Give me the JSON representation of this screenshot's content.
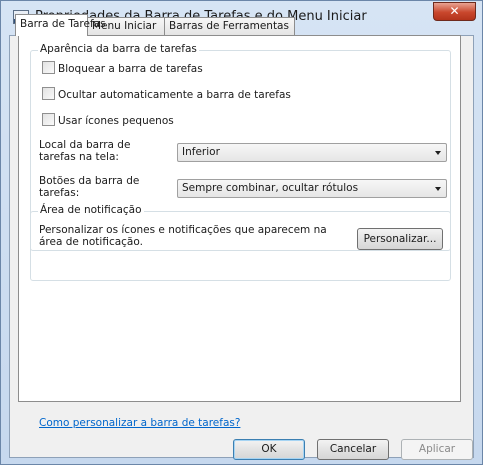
{
  "window": {
    "title": "Propriedades da Barra de Tarefas e do Menu Iniciar",
    "close_symbol": "✕"
  },
  "tabs": [
    {
      "label": "Barra de Tarefas",
      "active": true
    },
    {
      "label": "Menu Iniciar",
      "active": false
    },
    {
      "label": "Barras de Ferramentas",
      "active": false
    }
  ],
  "appearance": {
    "legend": "Aparência da barra de tarefas",
    "checkboxes": [
      {
        "label": "Bloquear a barra de tarefas",
        "checked": false
      },
      {
        "label": "Ocultar automaticamente a barra de tarefas",
        "checked": false
      },
      {
        "label": "Usar ícones pequenos",
        "checked": false
      }
    ],
    "location_label": "Local da barra de tarefas na tela:",
    "location_value": "Inferior",
    "buttons_label": "Botões da barra de tarefas:",
    "buttons_value": "Sempre combinar, ocultar rótulos"
  },
  "notification": {
    "legend": "Área de notificação",
    "description": "Personalizar os ícones e notificações que aparecem na área de notificação.",
    "customize_button": "Personalizar..."
  },
  "help_link": "Como personalizar a barra de tarefas?",
  "footer": {
    "ok": "OK",
    "cancel": "Cancelar",
    "apply": "Aplicar"
  },
  "colors": {
    "link": "#0066cc",
    "close_button": "#c9472d"
  }
}
